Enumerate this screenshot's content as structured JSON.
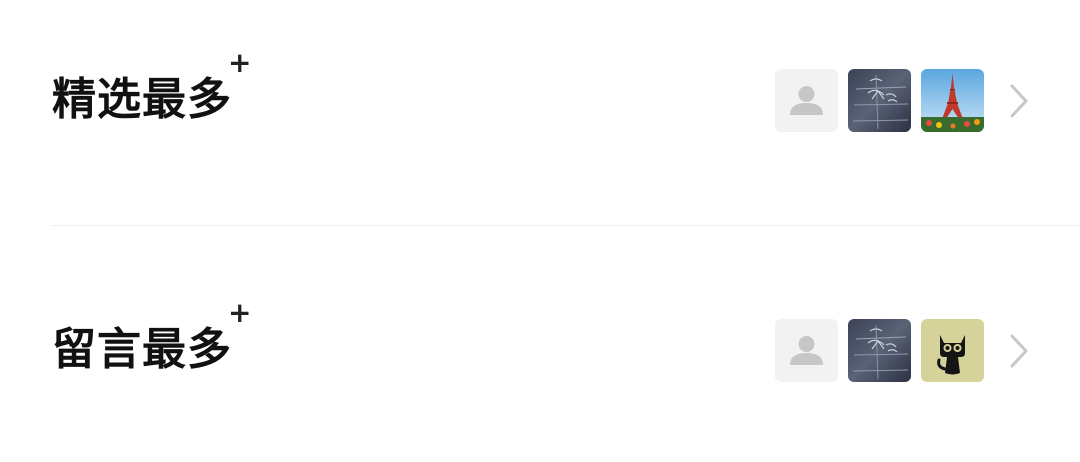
{
  "sections": [
    {
      "title": "精选最多",
      "badge": "+",
      "avatars": [
        "default-user-avatar",
        "handwriting-photo-avatar",
        "eiffel-tower-photo-avatar"
      ],
      "chevron": "chevron-right-icon"
    },
    {
      "title": "留言最多",
      "badge": "+",
      "avatars": [
        "default-user-avatar",
        "handwriting-photo-avatar",
        "black-cat-avatar"
      ],
      "chevron": "chevron-right-icon"
    }
  ],
  "colors": {
    "background": "#ffffff",
    "title": "#111111",
    "divider": "#eeeeee",
    "chevron": "#c7c7c7",
    "placeholder_bg": "#f2f2f2",
    "placeholder_fg": "#c6c6c6",
    "cat_bg": "#d6d39a"
  }
}
